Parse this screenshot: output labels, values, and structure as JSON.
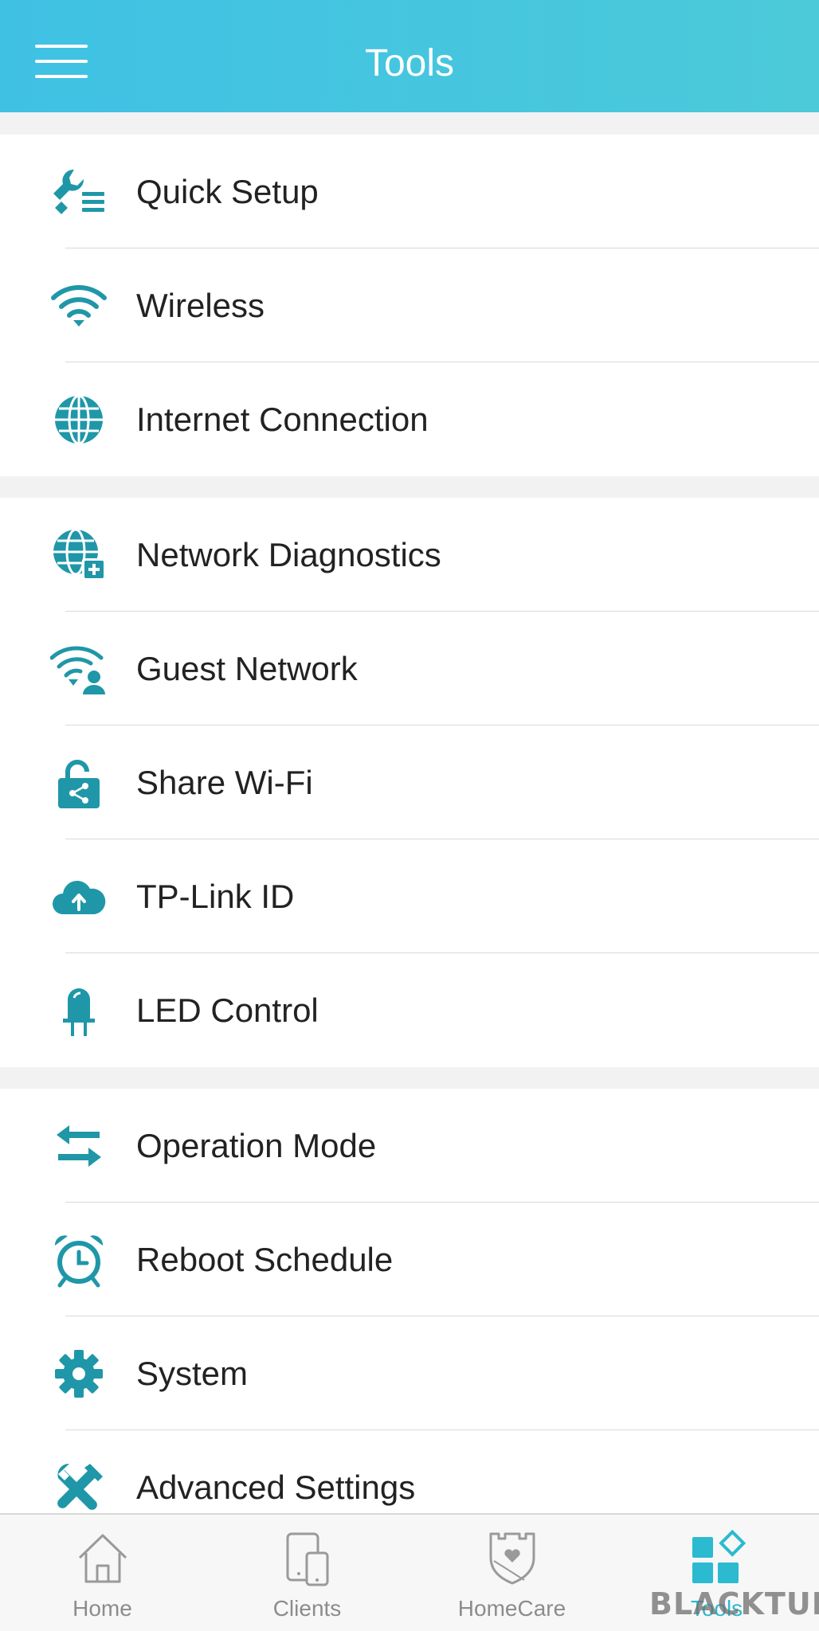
{
  "header": {
    "title": "Tools"
  },
  "colors": {
    "accent": "#1f97a8",
    "header_start": "#3fc1e4",
    "header_end": "#4ccad9",
    "active_tab": "#2bbad0"
  },
  "groups": [
    {
      "items": [
        {
          "label": "Quick Setup",
          "icon": "quick-setup-icon"
        },
        {
          "label": "Wireless",
          "icon": "wifi-icon"
        },
        {
          "label": "Internet Connection",
          "icon": "globe-icon"
        }
      ]
    },
    {
      "items": [
        {
          "label": "Network Diagnostics",
          "icon": "network-diagnostics-icon"
        },
        {
          "label": "Guest Network",
          "icon": "guest-network-icon"
        },
        {
          "label": "Share Wi-Fi",
          "icon": "share-lock-icon"
        },
        {
          "label": "TP-Link ID",
          "icon": "cloud-upload-icon"
        },
        {
          "label": "LED Control",
          "icon": "led-icon"
        }
      ]
    },
    {
      "items": [
        {
          "label": "Operation Mode",
          "icon": "swap-arrows-icon"
        },
        {
          "label": "Reboot Schedule",
          "icon": "alarm-clock-icon"
        },
        {
          "label": "System",
          "icon": "gear-icon"
        },
        {
          "label": "Advanced Settings",
          "icon": "tools-icon"
        }
      ]
    }
  ],
  "tabbar": {
    "tabs": [
      {
        "label": "Home",
        "icon": "home-icon",
        "active": false
      },
      {
        "label": "Clients",
        "icon": "devices-icon",
        "active": false
      },
      {
        "label": "HomeCare",
        "icon": "shield-heart-icon",
        "active": false
      },
      {
        "label": "Tools",
        "icon": "tools-grid-icon",
        "active": true
      }
    ]
  },
  "watermark": "BLACKTUBI"
}
